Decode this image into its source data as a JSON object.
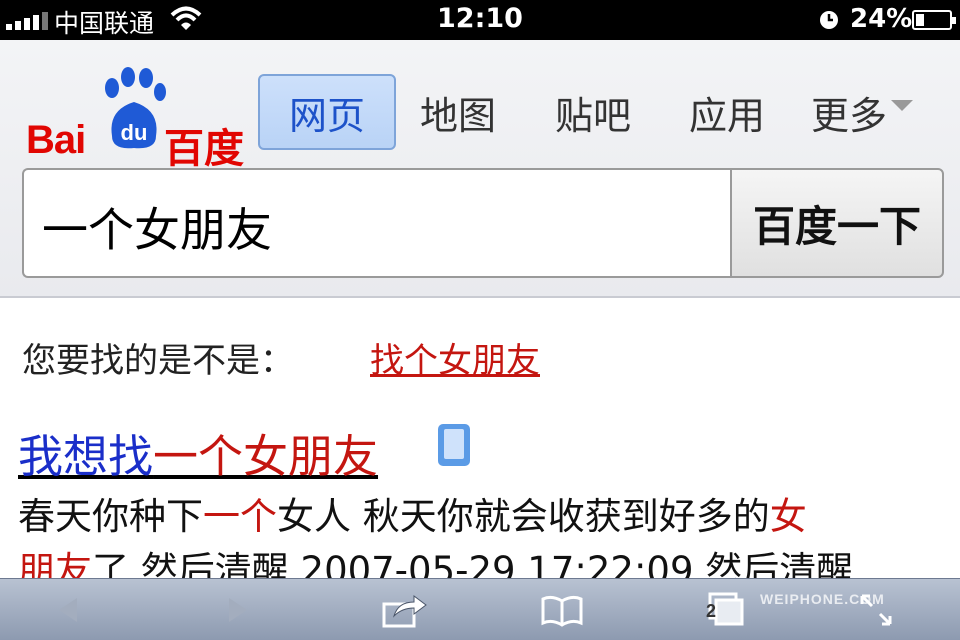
{
  "status_bar": {
    "carrier": "中国联通",
    "time": "12:10",
    "battery_percent": "24%",
    "battery_level": 0.24,
    "icons": [
      "signal-icon",
      "wifi-icon",
      "alarm-clock-icon",
      "battery-icon"
    ]
  },
  "header": {
    "logo_text_left": "Bai",
    "logo_text_paw": "du",
    "logo_text_right": "百度",
    "tabs": [
      {
        "label": "网页",
        "active": true
      },
      {
        "label": "地图",
        "active": false
      },
      {
        "label": "贴吧",
        "active": false
      },
      {
        "label": "应用",
        "active": false
      },
      {
        "label": "更多",
        "active": false
      }
    ],
    "search_value": "一个女朋友",
    "search_button": "百度一下"
  },
  "suggestion": {
    "prompt": "您要找的是不是：",
    "link": "找个女朋友"
  },
  "result": {
    "title_part1": "我想找",
    "title_part2": "一个女朋友",
    "snippet": {
      "l1_a": "春天你种下",
      "l1_hl": "一个",
      "l1_b": "女人 秋天你就会收获到好多的",
      "l1_hl2": "女",
      "l2_hl": "朋友",
      "l2_b": "了 然后清醒 2007-05-29 17:22:09 然后清醒"
    }
  },
  "toolbar": {
    "tab_count": "2",
    "watermark": "WEIPHONE.COM",
    "icons": [
      "back-icon",
      "forward-icon",
      "share-icon",
      "bookmarks-icon",
      "tabs-icon",
      "fullscreen-icon"
    ]
  },
  "colors": {
    "brand_red": "#e10602",
    "brand_blue": "#1f5ad6",
    "link_red": "#c41610",
    "link_blue": "#1a2ec9"
  }
}
